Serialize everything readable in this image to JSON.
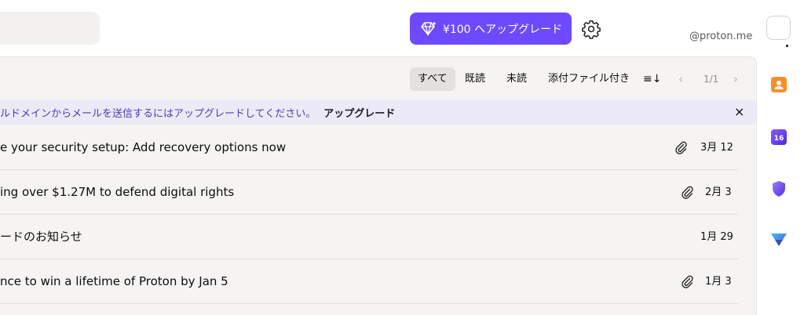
{
  "header": {
    "upgrade_label": "¥100 へアップグレード",
    "email": "@proton.me"
  },
  "toolbar": {
    "filters": [
      "すべて",
      "既読",
      "未読",
      "添付ファイル付き"
    ],
    "sort_icon": "≡↓",
    "pager": "1/1"
  },
  "banner": {
    "text": "ルドメインからメールを送信するにはアップグレードしてください。",
    "link": "アップグレード",
    "close": "×"
  },
  "messages": [
    {
      "subject": "e your security setup: Add recovery options now",
      "date": "3月 12",
      "attachment": true
    },
    {
      "subject": "ing over $1.27M to defend digital rights",
      "date": "2月 3",
      "attachment": true
    },
    {
      "subject": "ードのお知らせ",
      "date": "1月 29",
      "attachment": false
    },
    {
      "subject": "nce to win a lifetime of Proton by Jan 5",
      "date": "1月 3",
      "attachment": true
    }
  ],
  "sidebar_apps": [
    {
      "icon": "contacts-icon",
      "color": "#f7902b"
    },
    {
      "icon": "calendar-icon",
      "color": "#6d4aff",
      "label": "16"
    },
    {
      "icon": "vpn-shield-icon",
      "color": "#6d4aff"
    },
    {
      "icon": "pass-icon",
      "color": "#3e6cd6"
    }
  ],
  "colors": {
    "accent": "#6d4aff",
    "banner_bg": "#edeaf7",
    "list_bg": "#f5f4f2"
  }
}
